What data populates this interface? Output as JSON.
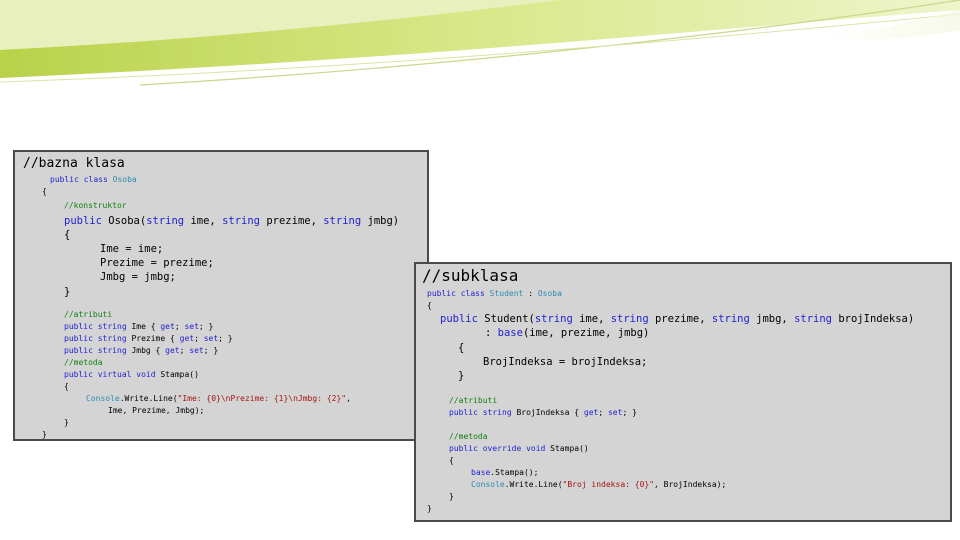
{
  "colors": {
    "keyword": "#1f1fd1",
    "type": "#2b8cae",
    "string": "#a31515",
    "comment": "#108010",
    "panel_bg": "#d4d4d4",
    "panel_border": "#4a4a4a",
    "accent_green": "#c8dc6e"
  },
  "base_panel": {
    "header": "//bazna klasa",
    "lines": [
      [
        {
          "t": "public",
          "c": "k"
        },
        {
          "t": " "
        },
        {
          "t": "class",
          "c": "k"
        },
        {
          "t": " "
        },
        {
          "t": "Osoba",
          "c": "t"
        }
      ],
      [
        {
          "t": "{"
        }
      ],
      [
        {
          "t": "//konstruktor",
          "c": "c"
        }
      ],
      [
        {
          "t": "public",
          "c": "k"
        },
        {
          "t": " Osoba("
        },
        {
          "t": "string",
          "c": "k"
        },
        {
          "t": " ime, "
        },
        {
          "t": "string",
          "c": "k"
        },
        {
          "t": " prezime, "
        },
        {
          "t": "string",
          "c": "k"
        },
        {
          "t": " jmbg)"
        }
      ],
      [
        {
          "t": "{"
        }
      ],
      [
        {
          "t": "Ime = ime;"
        }
      ],
      [
        {
          "t": "Prezime = prezime;"
        }
      ],
      [
        {
          "t": "Jmbg = jmbg;"
        }
      ],
      [
        {
          "t": "}"
        }
      ],
      [
        {
          "t": "//atributi",
          "c": "c"
        }
      ],
      [
        {
          "t": "public",
          "c": "k"
        },
        {
          "t": " "
        },
        {
          "t": "string",
          "c": "k"
        },
        {
          "t": " Ime { "
        },
        {
          "t": "get",
          "c": "k"
        },
        {
          "t": "; "
        },
        {
          "t": "set",
          "c": "k"
        },
        {
          "t": "; }"
        }
      ],
      [
        {
          "t": "public",
          "c": "k"
        },
        {
          "t": " "
        },
        {
          "t": "string",
          "c": "k"
        },
        {
          "t": " Prezime { "
        },
        {
          "t": "get",
          "c": "k"
        },
        {
          "t": "; "
        },
        {
          "t": "set",
          "c": "k"
        },
        {
          "t": "; }"
        }
      ],
      [
        {
          "t": "public",
          "c": "k"
        },
        {
          "t": " "
        },
        {
          "t": "string",
          "c": "k"
        },
        {
          "t": " Jmbg { "
        },
        {
          "t": "get",
          "c": "k"
        },
        {
          "t": "; "
        },
        {
          "t": "set",
          "c": "k"
        },
        {
          "t": "; }"
        }
      ],
      [
        {
          "t": "//metoda",
          "c": "c"
        }
      ],
      [
        {
          "t": "public",
          "c": "k"
        },
        {
          "t": " "
        },
        {
          "t": "virtual",
          "c": "k"
        },
        {
          "t": " "
        },
        {
          "t": "void",
          "c": "k"
        },
        {
          "t": " Stampa()"
        }
      ],
      [
        {
          "t": "{"
        }
      ],
      [
        {
          "t": "Console",
          "c": "t"
        },
        {
          "t": ".Write.Line("
        },
        {
          "t": "\"Ime: {0}\\nPrezime: {1}\\nJmbg: {2}\"",
          "c": "s"
        },
        {
          "t": ","
        }
      ],
      [
        {
          "t": "Ime, Prezime, Jmbg);"
        }
      ],
      [
        {
          "t": "}"
        }
      ],
      [
        {
          "t": "}"
        }
      ]
    ]
  },
  "sub_panel": {
    "header": "//subklasa",
    "lines": [
      [
        {
          "t": "public",
          "c": "k"
        },
        {
          "t": " "
        },
        {
          "t": "class",
          "c": "k"
        },
        {
          "t": " "
        },
        {
          "t": "Student",
          "c": "t"
        },
        {
          "t": " : "
        },
        {
          "t": "Osoba",
          "c": "t"
        }
      ],
      [
        {
          "t": "{"
        }
      ],
      [
        {
          "t": "public",
          "c": "k"
        },
        {
          "t": " Student("
        },
        {
          "t": "string",
          "c": "k"
        },
        {
          "t": " ime, "
        },
        {
          "t": "string",
          "c": "k"
        },
        {
          "t": " prezime, "
        },
        {
          "t": "string",
          "c": "k"
        },
        {
          "t": " jmbg, "
        },
        {
          "t": "string",
          "c": "k"
        },
        {
          "t": " brojIndeksa)"
        }
      ],
      [
        {
          "t": ": "
        },
        {
          "t": "base",
          "c": "k"
        },
        {
          "t": "(ime, prezime, jmbg)"
        }
      ],
      [
        {
          "t": "{"
        }
      ],
      [
        {
          "t": "BrojIndeksa = brojIndeksa;"
        }
      ],
      [
        {
          "t": "}"
        }
      ],
      [
        {
          "t": "//atributi",
          "c": "c"
        }
      ],
      [
        {
          "t": "public",
          "c": "k"
        },
        {
          "t": " "
        },
        {
          "t": "string",
          "c": "k"
        },
        {
          "t": " BrojIndeksa { "
        },
        {
          "t": "get",
          "c": "k"
        },
        {
          "t": "; "
        },
        {
          "t": "set",
          "c": "k"
        },
        {
          "t": "; }"
        }
      ],
      [
        {
          "t": "//metoda",
          "c": "c"
        }
      ],
      [
        {
          "t": "public",
          "c": "k"
        },
        {
          "t": " "
        },
        {
          "t": "override",
          "c": "k"
        },
        {
          "t": " "
        },
        {
          "t": "void",
          "c": "k"
        },
        {
          "t": " Stampa()"
        }
      ],
      [
        {
          "t": "{"
        }
      ],
      [
        {
          "t": "base",
          "c": "k"
        },
        {
          "t": ".Stampa();"
        }
      ],
      [
        {
          "t": "Console",
          "c": "t"
        },
        {
          "t": ".Write.Line("
        },
        {
          "t": "\"Broj indeksa: {0}\"",
          "c": "s"
        },
        {
          "t": ", BrojIndeksa);"
        }
      ],
      [
        {
          "t": "}"
        }
      ],
      [
        {
          "t": "}"
        }
      ]
    ]
  }
}
